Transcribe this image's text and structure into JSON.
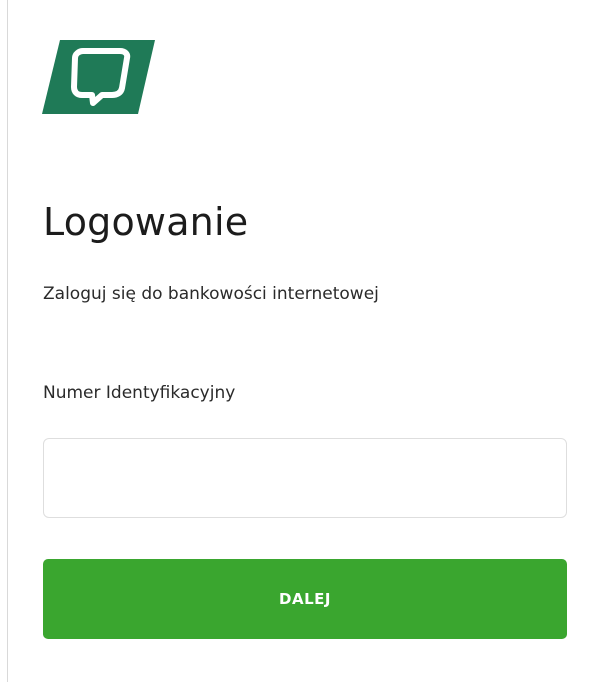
{
  "login": {
    "title": "Logowanie",
    "subtitle": "Zaloguj się do bankowości internetowej",
    "id_label": "Numer Identyfikacyjny",
    "id_value": "",
    "submit_label": "DALEJ"
  },
  "colors": {
    "brand_green": "#1f7a57",
    "button_green": "#3aa62f"
  },
  "icons": {
    "logo": "bank-logo-icon"
  }
}
